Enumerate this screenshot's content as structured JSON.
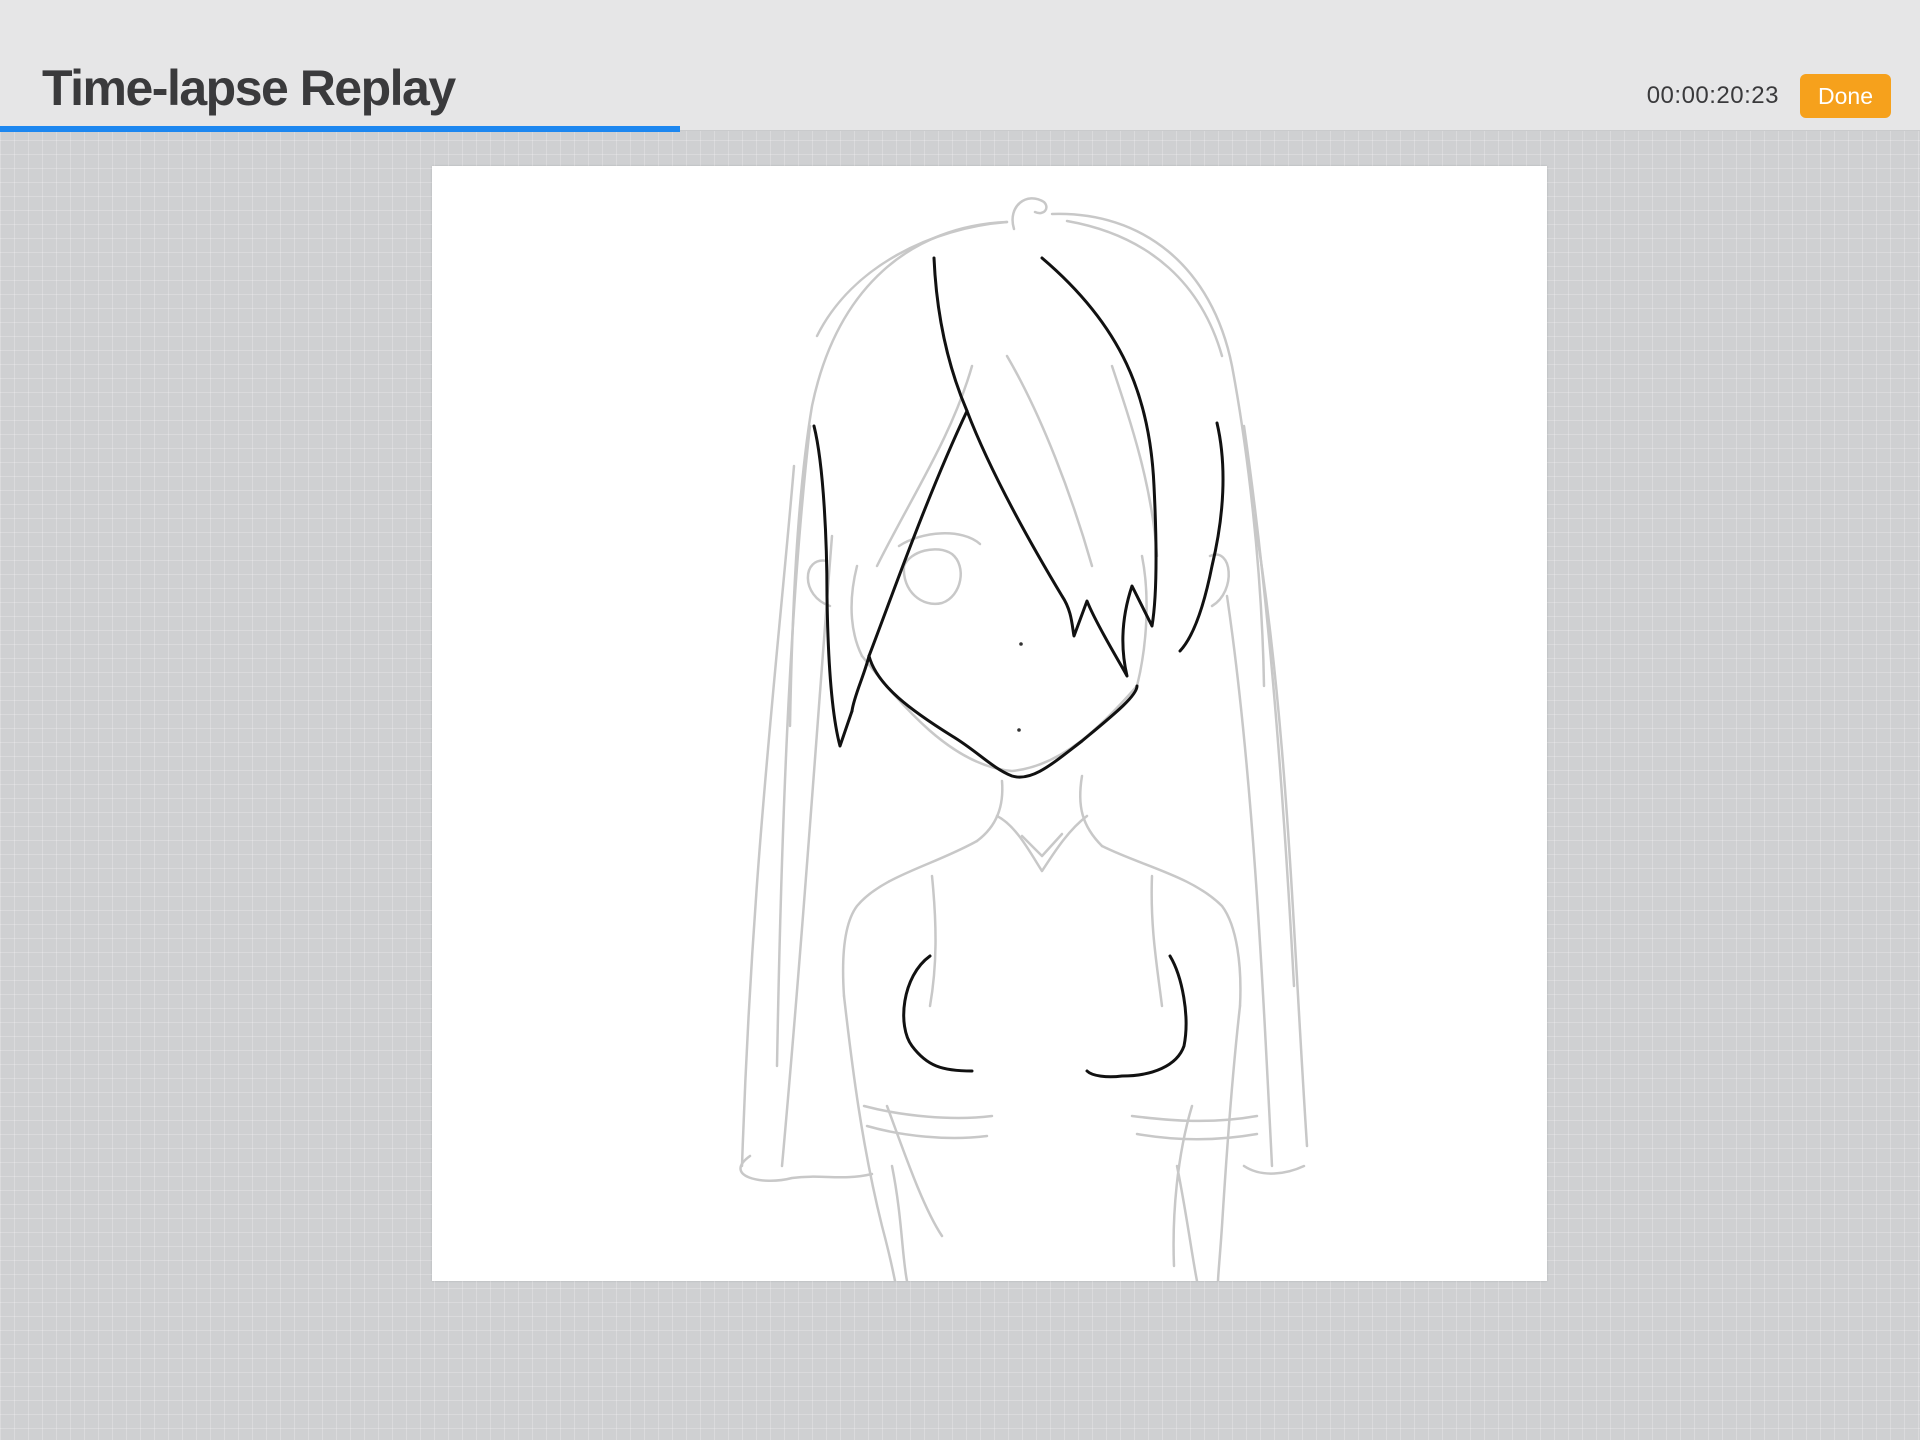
{
  "header": {
    "title": "Time-lapse Replay",
    "timer": "00:00:20:23",
    "done_label": "Done"
  },
  "playback": {
    "progress_fraction": 0.354
  },
  "colors": {
    "accent": "#1d87f0",
    "done_button": "#f6a11c",
    "sketch_line": "#c8c8c8",
    "ink_line": "#111111"
  }
}
